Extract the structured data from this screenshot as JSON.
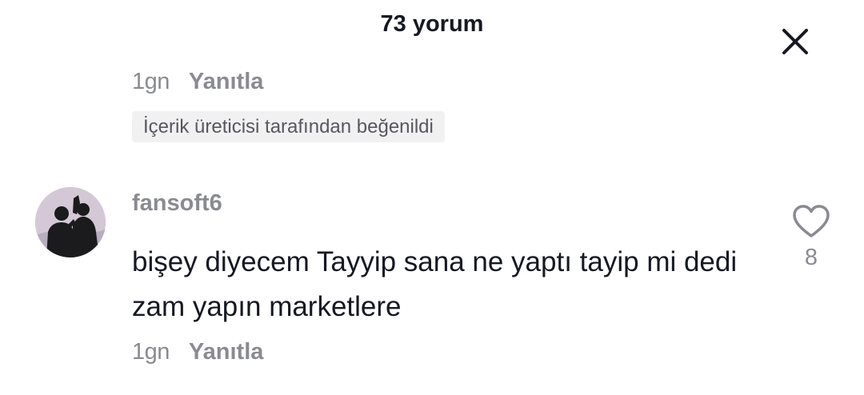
{
  "header": {
    "title": "73 yorum",
    "close_icon": "close-icon"
  },
  "previous_comment": {
    "time": "1gn",
    "reply_label": "Yanıtla",
    "liked_badge": "İçerik üreticisi tarafından beğenildi"
  },
  "comment": {
    "avatar_icon": "avatar",
    "username": "fansoft6",
    "text": "bişey diyecem Tayyip sana ne yaptı tayip mi dedi zam yapın marketlere",
    "time": "1gn",
    "reply_label": "Yanıtla",
    "like_icon": "heart-icon",
    "like_count": "8"
  },
  "colors": {
    "primary_text": "#161823",
    "secondary_text": "#8a8b91",
    "badge_bg": "#f1f1f2"
  }
}
